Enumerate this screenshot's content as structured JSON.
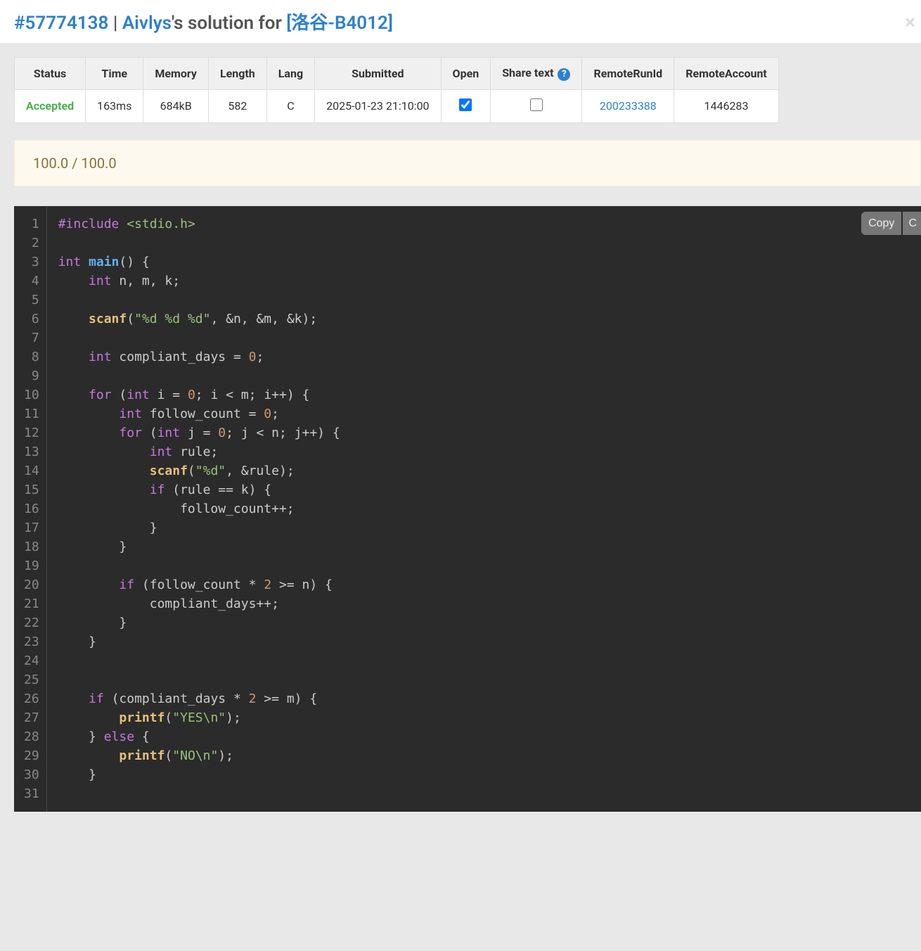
{
  "header": {
    "submission_id": "#57774138",
    "sep": " | ",
    "user": "Aivlys",
    "mid": "'s solution for ",
    "problem": "[洛谷-B4012]"
  },
  "table": {
    "headers": {
      "status": "Status",
      "time": "Time",
      "memory": "Memory",
      "length": "Length",
      "lang": "Lang",
      "submitted": "Submitted",
      "open": "Open",
      "share": "Share text",
      "remoterun": "RemoteRunId",
      "remoteacc": "RemoteAccount"
    },
    "row": {
      "status": "Accepted",
      "time": "163ms",
      "memory": "684kB",
      "length": "582",
      "lang": "C",
      "submitted": "2025-01-23 21:10:00",
      "open_checked": true,
      "share_checked": false,
      "remoterun": "200233388",
      "remoteacc": "1446283"
    }
  },
  "score": "100.0 / 100.0",
  "toolbar": {
    "copy": "Copy",
    "lang": "C"
  },
  "code_lines": [
    [
      [
        "pp",
        "#include"
      ],
      [
        "op",
        " "
      ],
      [
        "inc",
        "<stdio.h>"
      ]
    ],
    [],
    [
      [
        "type",
        "int"
      ],
      [
        "op",
        " "
      ],
      [
        "fn",
        "main"
      ],
      [
        "punc",
        "() {"
      ]
    ],
    [
      [
        "op",
        "    "
      ],
      [
        "type",
        "int"
      ],
      [
        "op",
        " "
      ],
      [
        "id",
        "n, m, k;"
      ]
    ],
    [],
    [
      [
        "op",
        "    "
      ],
      [
        "fnc",
        "scanf"
      ],
      [
        "punc",
        "("
      ],
      [
        "str",
        "\"%d %d %d\""
      ],
      [
        "punc",
        ", &n, &m, &k);"
      ]
    ],
    [],
    [
      [
        "op",
        "    "
      ],
      [
        "type",
        "int"
      ],
      [
        "op",
        " "
      ],
      [
        "id",
        "compliant_days = "
      ],
      [
        "num",
        "0"
      ],
      [
        "punc",
        ";"
      ]
    ],
    [],
    [
      [
        "op",
        "    "
      ],
      [
        "kw",
        "for"
      ],
      [
        "op",
        " ("
      ],
      [
        "type",
        "int"
      ],
      [
        "op",
        " i = "
      ],
      [
        "num",
        "0"
      ],
      [
        "op",
        "; i < m; i++) {"
      ]
    ],
    [
      [
        "op",
        "        "
      ],
      [
        "type",
        "int"
      ],
      [
        "op",
        " follow_count = "
      ],
      [
        "num",
        "0"
      ],
      [
        "punc",
        ";"
      ]
    ],
    [
      [
        "op",
        "        "
      ],
      [
        "kw",
        "for"
      ],
      [
        "op",
        " ("
      ],
      [
        "type",
        "int"
      ],
      [
        "op",
        " j = "
      ],
      [
        "num",
        "0"
      ],
      [
        "op",
        "; j < n; j++) {"
      ]
    ],
    [
      [
        "op",
        "            "
      ],
      [
        "type",
        "int"
      ],
      [
        "op",
        " rule;"
      ]
    ],
    [
      [
        "op",
        "            "
      ],
      [
        "fnc",
        "scanf"
      ],
      [
        "punc",
        "("
      ],
      [
        "str",
        "\"%d\""
      ],
      [
        "punc",
        ", &rule);"
      ]
    ],
    [
      [
        "op",
        "            "
      ],
      [
        "kw",
        "if"
      ],
      [
        "op",
        " (rule == k) {"
      ]
    ],
    [
      [
        "op",
        "                follow_count++;"
      ]
    ],
    [
      [
        "op",
        "            }"
      ]
    ],
    [
      [
        "op",
        "        }"
      ]
    ],
    [],
    [
      [
        "op",
        "        "
      ],
      [
        "kw",
        "if"
      ],
      [
        "op",
        " (follow_count * "
      ],
      [
        "num",
        "2"
      ],
      [
        "op",
        " >= n) {"
      ]
    ],
    [
      [
        "op",
        "            compliant_days++;"
      ]
    ],
    [
      [
        "op",
        "        }"
      ]
    ],
    [
      [
        "op",
        "    }"
      ]
    ],
    [],
    [],
    [
      [
        "op",
        "    "
      ],
      [
        "kw",
        "if"
      ],
      [
        "op",
        " (compliant_days * "
      ],
      [
        "num",
        "2"
      ],
      [
        "op",
        " >= m) {"
      ]
    ],
    [
      [
        "op",
        "        "
      ],
      [
        "fnc",
        "printf"
      ],
      [
        "punc",
        "("
      ],
      [
        "str",
        "\"YES\\n\""
      ],
      [
        "punc",
        ");"
      ]
    ],
    [
      [
        "op",
        "    } "
      ],
      [
        "kw",
        "else"
      ],
      [
        "op",
        " {"
      ]
    ],
    [
      [
        "op",
        "        "
      ],
      [
        "fnc",
        "printf"
      ],
      [
        "punc",
        "("
      ],
      [
        "str",
        "\"NO\\n\""
      ],
      [
        "punc",
        ");"
      ]
    ],
    [
      [
        "op",
        "    }"
      ]
    ],
    []
  ]
}
